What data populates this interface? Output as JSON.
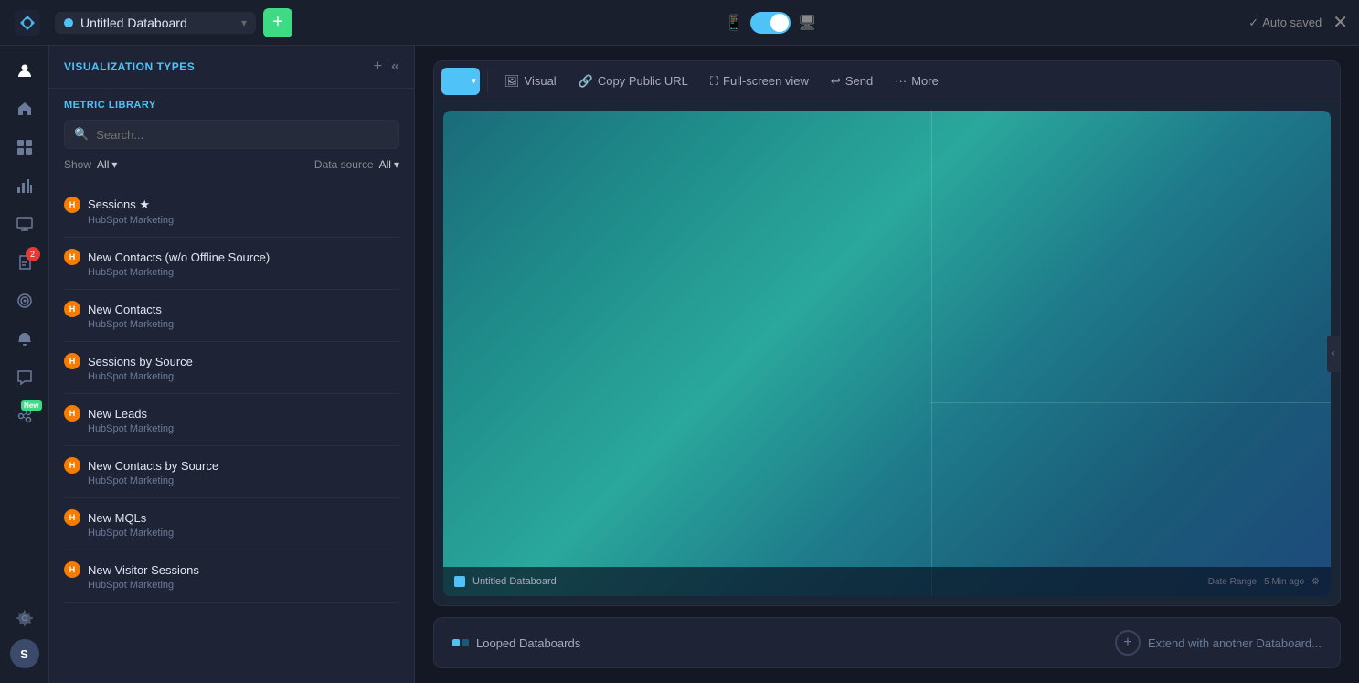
{
  "topbar": {
    "logo_label": "Databoard Logo",
    "title": "Untitled Databoard",
    "add_button_label": "+",
    "auto_saved_label": "Auto saved",
    "close_label": "✕",
    "toggle_label": "Toggle view"
  },
  "sidebar_panel": {
    "title": "VISUALIZATION TYPES",
    "add_icon": "+",
    "collapse_icon": "«"
  },
  "metric_library": {
    "title": "METRIC LIBRARY",
    "search_placeholder": "Search...",
    "show_label": "Show",
    "show_value": "All",
    "datasource_label": "Data source",
    "datasource_value": "All",
    "items": [
      {
        "name": "Sessions ★",
        "source": "HubSpot Marketing",
        "starred": true
      },
      {
        "name": "New Contacts (w/o Offline Source)",
        "source": "HubSpot Marketing",
        "starred": false
      },
      {
        "name": "New Contacts",
        "source": "HubSpot Marketing",
        "starred": false
      },
      {
        "name": "Sessions by Source",
        "source": "HubSpot Marketing",
        "starred": false
      },
      {
        "name": "New Leads",
        "source": "HubSpot Marketing",
        "starred": false
      },
      {
        "name": "New Contacts by Source",
        "source": "HubSpot Marketing",
        "starred": false
      },
      {
        "name": "New MQLs",
        "source": "HubSpot Marketing",
        "starred": false
      },
      {
        "name": "New Visitor Sessions",
        "source": "HubSpot Marketing",
        "starred": false
      }
    ]
  },
  "toolbar": {
    "visual_label": "Visual",
    "copy_url_label": "Copy Public URL",
    "fullscreen_label": "Full-screen view",
    "send_label": "Send",
    "more_label": "More"
  },
  "preview": {
    "board_title": "Untitled Databoard",
    "last_range": "Date Range",
    "refresh": "5 Min ago"
  },
  "bottom_bar": {
    "loop_label": "Looped Databoards",
    "extend_label": "Extend with another Databoard..."
  },
  "nav": {
    "items": [
      {
        "icon": "👤",
        "label": "profile-icon",
        "badge": null
      },
      {
        "icon": "⌂",
        "label": "home-icon",
        "badge": null
      },
      {
        "icon": "📊",
        "label": "dashboard-icon",
        "badge": null
      },
      {
        "icon": "📈",
        "label": "metrics-icon",
        "badge": null
      },
      {
        "icon": "▶",
        "label": "presentation-icon",
        "badge": null
      },
      {
        "icon": "📋",
        "label": "reports-icon",
        "badge": "2"
      },
      {
        "icon": "🎯",
        "label": "goals-icon",
        "badge": null
      },
      {
        "icon": "🔔",
        "label": "alerts-icon",
        "badge": null
      },
      {
        "icon": "💬",
        "label": "chat-icon",
        "badge": null
      },
      {
        "icon": "🌐",
        "label": "integrations-icon",
        "badge_new": true
      }
    ],
    "bottom": [
      {
        "icon": "⚙",
        "label": "settings-icon"
      },
      {
        "avatar": "S",
        "label": "user-avatar"
      }
    ]
  },
  "colors": {
    "accent_blue": "#4fc3f7",
    "accent_green": "#3ddc84",
    "hubspot_orange": "#f57c00",
    "teal_preview": "#2aa89c"
  }
}
